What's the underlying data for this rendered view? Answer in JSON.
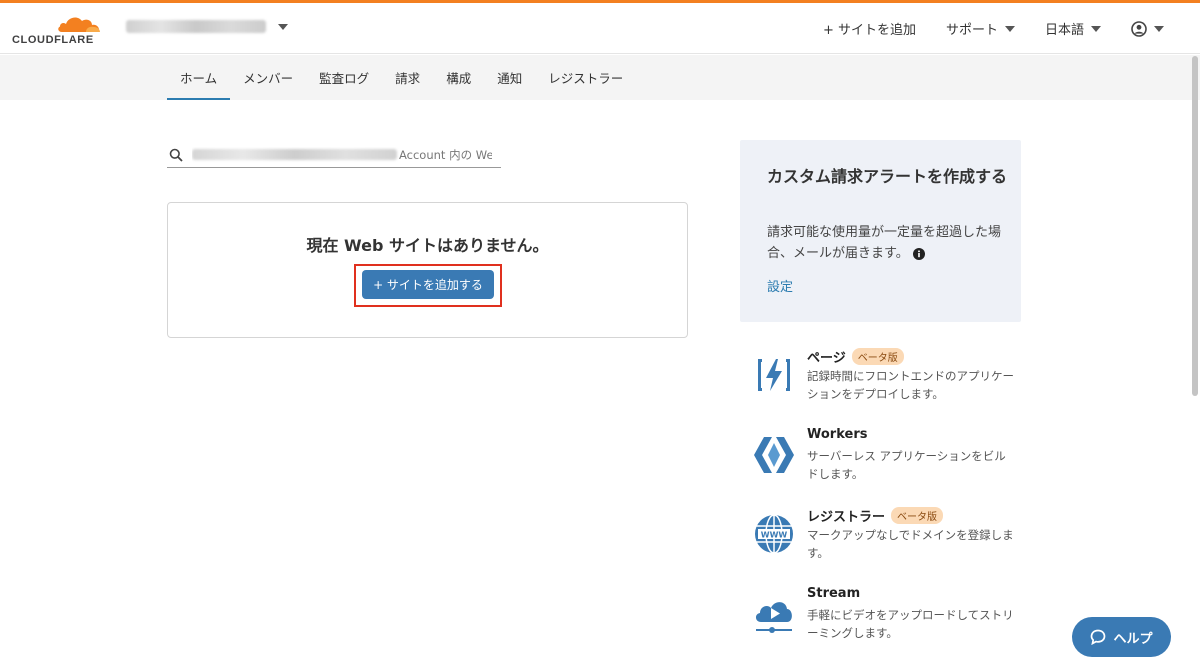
{
  "header": {
    "logo_text": "CLOUDFLARE",
    "add_site": "+ サイトを追加",
    "support": "サポート",
    "language": "日本語"
  },
  "tabs": [
    {
      "label": "ホーム",
      "active": true
    },
    {
      "label": "メンバー"
    },
    {
      "label": "監査ログ"
    },
    {
      "label": "請求"
    },
    {
      "label": "構成"
    },
    {
      "label": "通知"
    },
    {
      "label": "レジストラー"
    }
  ],
  "search": {
    "placeholder_suffix": "Account 内の Web"
  },
  "empty_state": {
    "title": "現在 Web サイトはありません。",
    "button": "+ サイトを追加する"
  },
  "alert_card": {
    "title": "カスタム請求アラートを作成する",
    "body": "請求可能な使用量が一定量を超過した場合、メールが届きます。",
    "link": "設定"
  },
  "products": [
    {
      "name": "ページ",
      "badge": "ベータ版",
      "desc": "記録時間にフロントエンドのアプリケーションをデプロイします。",
      "icon": "pages-bolt-icon"
    },
    {
      "name": "Workers",
      "desc": "サーバーレス アプリケーションをビルドします。",
      "icon": "workers-hex-icon"
    },
    {
      "name": "レジストラー",
      "badge": "ベータ版",
      "desc": "マークアップなしでドメインを登録します。",
      "icon": "www-globe-icon"
    },
    {
      "name": "Stream",
      "desc": "手軽にビデオをアップロードしてストリーミングします。",
      "icon": "stream-cloud-play-icon"
    }
  ],
  "help": {
    "label": "ヘルプ"
  },
  "colors": {
    "brand_orange": "#f38020",
    "primary_blue": "#3a7ab4",
    "link_blue": "#2c7cb0",
    "highlight_red": "#e0301e",
    "badge_bg": "#fbd9b5"
  }
}
